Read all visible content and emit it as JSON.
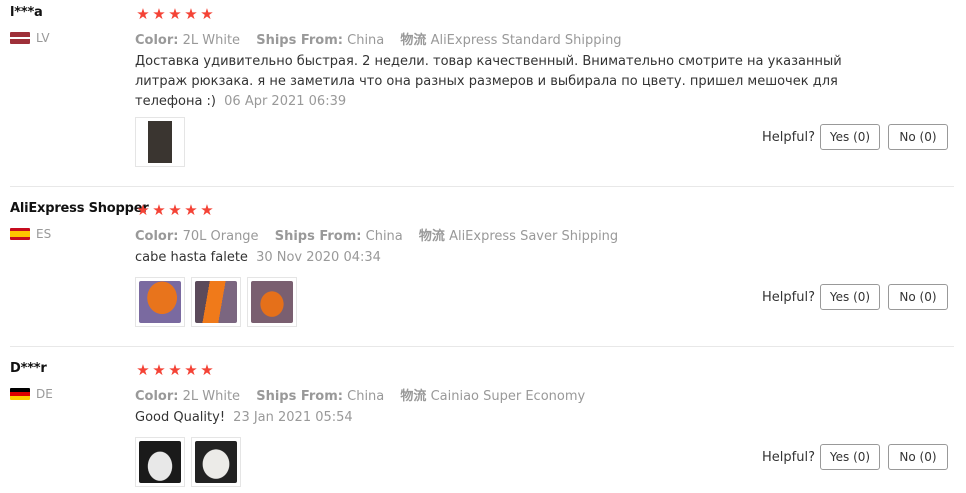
{
  "reviews": [
    {
      "user": "l***a",
      "country": "LV",
      "rating": 5,
      "props": [
        {
          "key": "Color:",
          "value": "2L White"
        },
        {
          "key": "Ships From:",
          "value": "China"
        },
        {
          "key": "物流",
          "value": "AliExpress Standard Shipping"
        }
      ],
      "text": "Доставка удивительно быстрая. 2 недели. товар качественный. Внимательно смотрите на указанный литраж рюкзака. я не заметила что она разных размеров и выбирала по цвету. пришел мешочек для телефона :)",
      "date": "06 Apr 2021 06:39",
      "images": 1,
      "helpful_label": "Helpful?",
      "yes": "Yes (0)",
      "no": "No (0)"
    },
    {
      "user": "AliExpress Shopper",
      "country": "ES",
      "rating": 5,
      "props": [
        {
          "key": "Color:",
          "value": "70L Orange"
        },
        {
          "key": "Ships From:",
          "value": "China"
        },
        {
          "key": "物流",
          "value": "AliExpress Saver Shipping"
        }
      ],
      "text": "cabe hasta falete",
      "date": "30 Nov 2020 04:34",
      "images": 3,
      "helpful_label": "Helpful?",
      "yes": "Yes (0)",
      "no": "No (0)"
    },
    {
      "user": "D***r",
      "country": "DE",
      "rating": 5,
      "props": [
        {
          "key": "Color:",
          "value": "2L White"
        },
        {
          "key": "Ships From:",
          "value": "China"
        },
        {
          "key": "物流",
          "value": "Cainiao Super Economy"
        }
      ],
      "text": "Good Quality!",
      "date": "23 Jan 2021 05:54",
      "images": 2,
      "helpful_label": "Helpful?",
      "yes": "Yes (0)",
      "no": "No (0)"
    }
  ],
  "star_glyph": "★",
  "colors": {
    "star": "#f44336",
    "muted": "#999999"
  }
}
